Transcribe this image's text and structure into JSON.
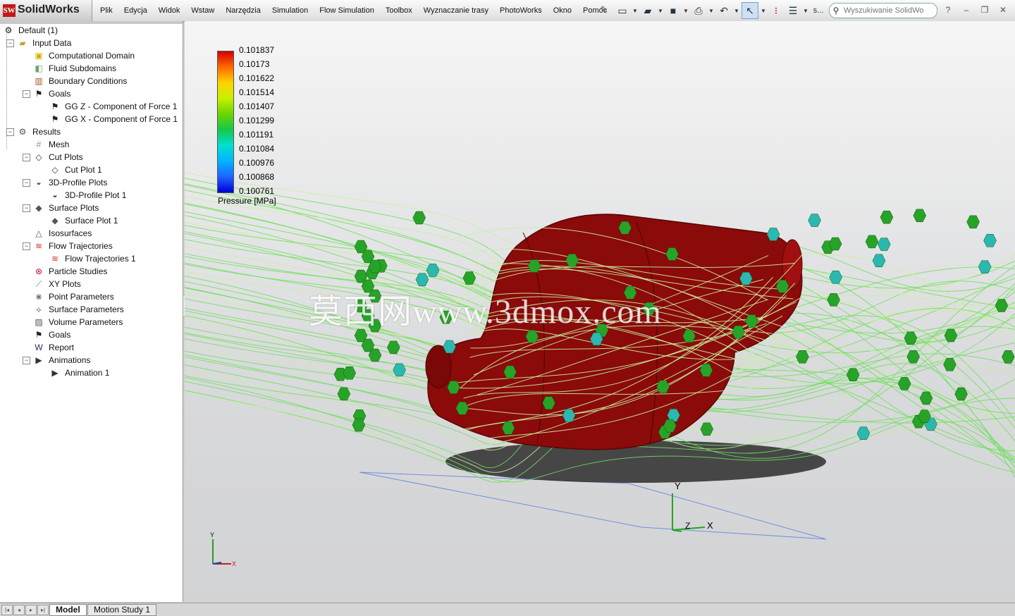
{
  "app": {
    "logo_mark": "SW",
    "name": "SolidWorks"
  },
  "menu": [
    "Plik",
    "Edycja",
    "Widok",
    "Wstaw",
    "Narzędzia",
    "Simulation",
    "Flow Simulation",
    "Toolbox",
    "Wyznaczanie trasy",
    "PhotoWorks",
    "Okno",
    "Pomoc"
  ],
  "toolbar": {
    "icons": [
      "new-document-icon",
      "open-folder-icon",
      "save-icon",
      "print-icon",
      "undo-icon",
      "select-arrow-icon",
      "traffic-light-icon",
      "options-icon"
    ],
    "ellipsis": "s..."
  },
  "search": {
    "placeholder": "Wyszukiwanie SolidWo"
  },
  "window_controls": [
    "?",
    "–",
    "❐",
    "✕"
  ],
  "tree": {
    "root": "Default (1)",
    "items": [
      {
        "label": "Input Data",
        "icon": "folder-icon"
      },
      {
        "label": "Computational Domain",
        "icon": "domain-box-icon"
      },
      {
        "label": "Fluid Subdomains",
        "icon": "subdomain-icon"
      },
      {
        "label": "Boundary Conditions",
        "icon": "boundary-icon"
      },
      {
        "label": "Goals",
        "icon": "checkered-flag-icon"
      },
      {
        "label": "GG Z - Component of Force 1",
        "icon": "checkered-flag-icon"
      },
      {
        "label": "GG X - Component of Force 1",
        "icon": "checkered-flag-icon"
      },
      {
        "label": "Results",
        "icon": "results-icon"
      },
      {
        "label": "Mesh",
        "icon": "mesh-icon"
      },
      {
        "label": "Cut Plots",
        "icon": "cut-plot-icon"
      },
      {
        "label": "Cut Plot 1",
        "icon": "cut-plot-icon"
      },
      {
        "label": "3D-Profile Plots",
        "icon": "profile-plot-icon"
      },
      {
        "label": "3D-Profile Plot 1",
        "icon": "profile-plot-icon"
      },
      {
        "label": "Surface Plots",
        "icon": "surface-plot-icon"
      },
      {
        "label": "Surface Plot 1",
        "icon": "surface-plot-icon"
      },
      {
        "label": "Isosurfaces",
        "icon": "isosurface-icon"
      },
      {
        "label": "Flow Trajectories",
        "icon": "flow-trajectories-icon"
      },
      {
        "label": "Flow Trajectories 1",
        "icon": "flow-trajectories-icon"
      },
      {
        "label": "Particle Studies",
        "icon": "particle-icon"
      },
      {
        "label": "XY Plots",
        "icon": "xy-plot-icon"
      },
      {
        "label": "Point Parameters",
        "icon": "point-parameters-icon"
      },
      {
        "label": "Surface Parameters",
        "icon": "surface-parameters-icon"
      },
      {
        "label": "Volume Parameters",
        "icon": "volume-parameters-icon"
      },
      {
        "label": "Goals",
        "icon": "checkered-flag-icon"
      },
      {
        "label": "Report",
        "icon": "report-icon"
      },
      {
        "label": "Animations",
        "icon": "animation-icon"
      },
      {
        "label": "Animation 1",
        "icon": "animation-icon"
      }
    ]
  },
  "legend": {
    "values": [
      "0.101837",
      "0.10173",
      "0.101622",
      "0.101514",
      "0.101407",
      "0.101299",
      "0.101191",
      "0.101084",
      "0.100976",
      "0.100868",
      "0.100761"
    ],
    "title": "Pressure [MPa]",
    "colors": [
      "#d40000",
      "#ff6a00",
      "#ffd200",
      "#c8f000",
      "#6ad400",
      "#16c84a",
      "#00e0d0",
      "#00b4ff",
      "#1e64ff",
      "#0000d8"
    ]
  },
  "watermark": "莫西网www.3dmox.com",
  "axes": {
    "y": "Y",
    "z": "Z",
    "x": "X"
  },
  "bottom": {
    "tabs": [
      "Model",
      "Motion Study 1"
    ]
  },
  "colors": {
    "body_red": "#8b0a0a",
    "trajectory_green": "#6ee05a",
    "marker_green": "#27a327",
    "marker_cyan": "#2ab8b0"
  }
}
